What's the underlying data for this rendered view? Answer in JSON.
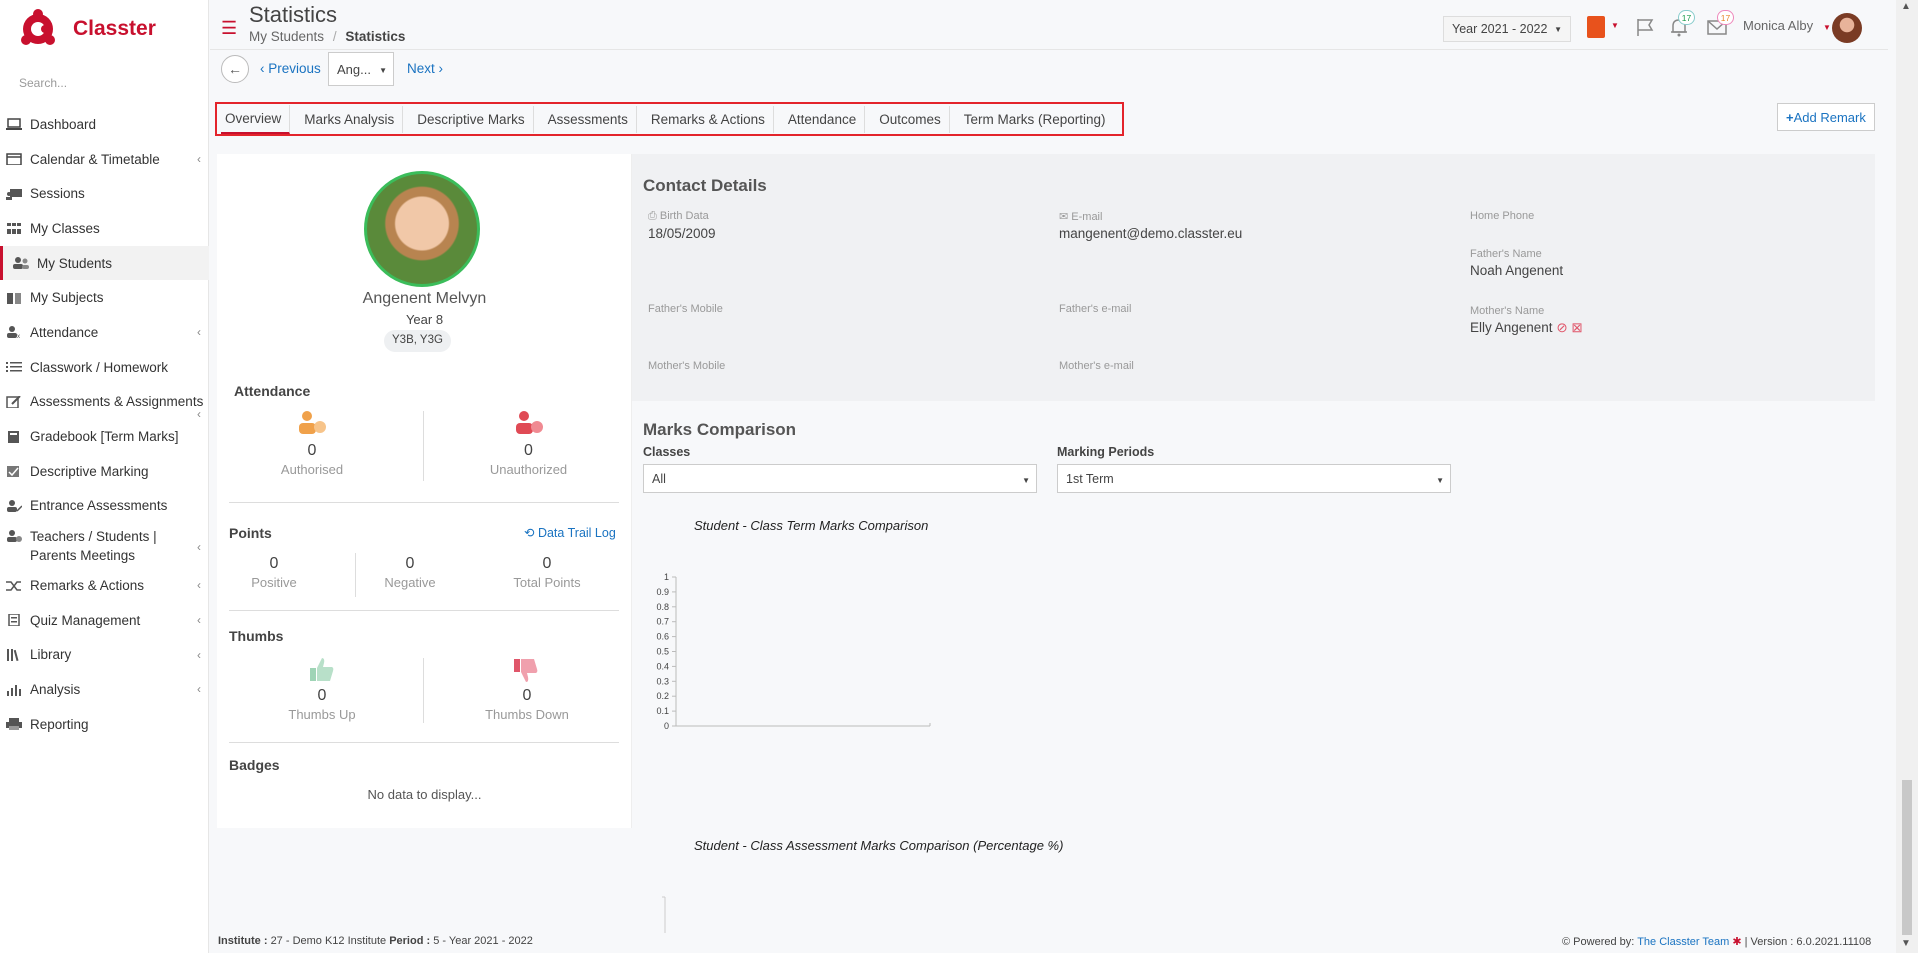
{
  "app": {
    "name": "Classter",
    "search_placeholder": "Search..."
  },
  "sidebar": {
    "items": [
      {
        "label": "Dashboard",
        "icon": "laptop-icon"
      },
      {
        "label": "Calendar & Timetable",
        "icon": "calendar-icon"
      },
      {
        "label": "Sessions",
        "icon": "presentation-icon"
      },
      {
        "label": "My Classes",
        "icon": "classes-icon"
      },
      {
        "label": "My Students",
        "icon": "students-icon"
      },
      {
        "label": "My Subjects",
        "icon": "book-icon"
      },
      {
        "label": "Attendance",
        "icon": "attendance-icon"
      },
      {
        "label": "Classwork / Homework",
        "icon": "list-icon"
      },
      {
        "label": "Assessments & Assignments",
        "icon": "edit-icon"
      },
      {
        "label": "Gradebook [Term Marks]",
        "icon": "gradebook-icon"
      },
      {
        "label": "Descriptive Marking",
        "icon": "marking-icon"
      },
      {
        "label": "Entrance Assessments",
        "icon": "entrance-icon"
      },
      {
        "label": "Teachers / Students | Parents Meetings",
        "icon": "meetings-icon"
      },
      {
        "label": "Remarks & Actions",
        "icon": "shuffle-icon"
      },
      {
        "label": "Quiz Management",
        "icon": "quiz-icon"
      },
      {
        "label": "Library",
        "icon": "library-icon"
      },
      {
        "label": "Analysis",
        "icon": "analysis-icon"
      },
      {
        "label": "Reporting",
        "icon": "printer-icon"
      }
    ]
  },
  "header": {
    "title": "Statistics",
    "breadcrumb": {
      "parent": "My Students",
      "sep": "/",
      "current": "Statistics"
    },
    "year": "Year 2021 - 2022",
    "notifications": "17",
    "messages": "17",
    "user": "Monica Alby"
  },
  "subnav": {
    "previous": "Previous",
    "student": "Ang...",
    "next": "Next"
  },
  "tabs": [
    "Overview",
    "Marks Analysis",
    "Descriptive Marks",
    "Assessments",
    "Remarks & Actions",
    "Attendance",
    "Outcomes",
    "Term Marks (Reporting)"
  ],
  "add_remark": "Add Remark",
  "student": {
    "name": "Angenent Melvyn",
    "year": "Year 8",
    "classes": "Y3B, Y3G"
  },
  "attendance": {
    "title": "Attendance",
    "authorised": {
      "value": "0",
      "label": "Authorised"
    },
    "unauthorized": {
      "value": "0",
      "label": "Unauthorized"
    }
  },
  "points": {
    "title": "Points",
    "trail": "Data Trail Log",
    "positive": {
      "value": "0",
      "label": "Positive"
    },
    "negative": {
      "value": "0",
      "label": "Negative"
    },
    "total": {
      "value": "0",
      "label": "Total Points"
    }
  },
  "thumbs": {
    "title": "Thumbs",
    "up": {
      "value": "0",
      "label": "Thumbs Up"
    },
    "down": {
      "value": "0",
      "label": "Thumbs Down"
    }
  },
  "badges": {
    "title": "Badges",
    "empty": "No data to display..."
  },
  "contact": {
    "title": "Contact Details",
    "birth": {
      "label": "Birth Data",
      "value": "18/05/2009"
    },
    "email": {
      "label": "E-mail",
      "value": "mangenent@demo.classter.eu"
    },
    "home_phone": {
      "label": "Home Phone",
      "value": ""
    },
    "father_name": {
      "label": "Father's Name",
      "value": "Noah Angenent"
    },
    "father_mobile": {
      "label": "Father's Mobile",
      "value": ""
    },
    "father_email": {
      "label": "Father's e-mail",
      "value": ""
    },
    "mother_name": {
      "label": "Mother's Name",
      "value": "Elly Angenent"
    },
    "mother_mobile": {
      "label": "Mother's Mobile",
      "value": ""
    },
    "mother_email": {
      "label": "Mother's e-mail",
      "value": ""
    }
  },
  "marks": {
    "title": "Marks Comparison",
    "classes_label": "Classes",
    "classes_value": "All",
    "periods_label": "Marking Periods",
    "periods_value": "1st Term",
    "chart1_title": "Student - Class Term Marks Comparison",
    "chart2_title": "Student - Class Assessment Marks Comparison (Percentage %)"
  },
  "chart_data": {
    "type": "bar",
    "title": "Student - Class Term Marks Comparison",
    "categories": [],
    "series": [],
    "ylim": [
      0,
      1
    ],
    "y_ticks": [
      "1",
      "0.9",
      "0.8",
      "0.7",
      "0.6",
      "0.5",
      "0.4",
      "0.3",
      "0.2",
      "0.1",
      "0"
    ]
  },
  "footer": {
    "institute_label": "Institute :",
    "institute": "27 - Demo K12 Institute",
    "period_label": "Period :",
    "period": "5 - Year 2021 - 2022",
    "powered": "Powered by:",
    "team": "The Classter Team",
    "version": "| Version : 6.0.2021.11108"
  },
  "colors": {
    "brand": "#c8102e",
    "link": "#1a73c1",
    "highlight": "#e3242b"
  }
}
